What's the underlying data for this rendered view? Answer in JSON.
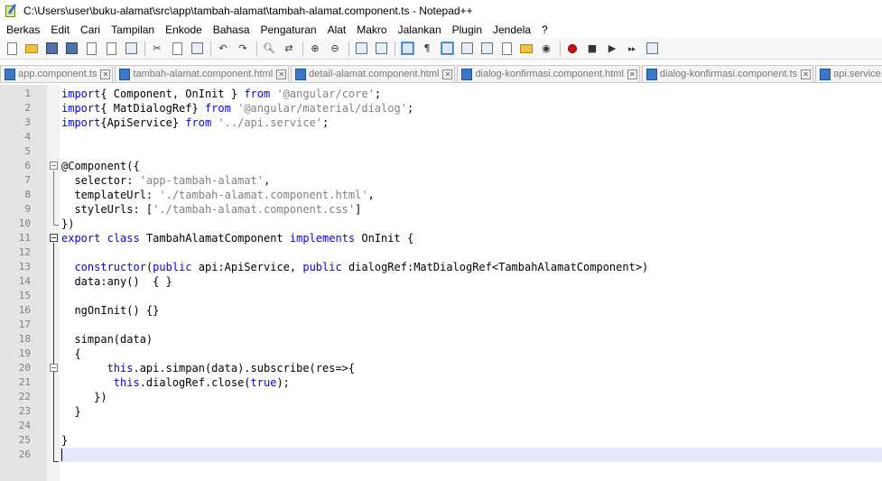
{
  "window": {
    "title": "C:\\Users\\user\\buku-alamat\\src\\app\\tambah-alamat\\tambah-alamat.component.ts - Notepad++"
  },
  "menu": [
    "Berkas",
    "Edit",
    "Cari",
    "Tampilan",
    "Enkode",
    "Bahasa",
    "Pengaturan",
    "Alat",
    "Makro",
    "Jalankan",
    "Plugin",
    "Jendela",
    "?"
  ],
  "toolbar": {
    "icons": [
      "new-file-icon",
      "open-file-icon",
      "save-icon",
      "save-all-icon",
      "close-icon",
      "close-all-icon",
      "print-icon",
      "cut-icon",
      "copy-icon",
      "paste-icon",
      "undo-icon",
      "redo-icon",
      "find-icon",
      "replace-icon",
      "zoom-in-icon",
      "zoom-out-icon",
      "sync-vertical-icon",
      "sync-horizontal-icon",
      "word-wrap-icon",
      "show-all-characters-icon",
      "indent-guide-icon",
      "user-defined-language-icon",
      "document-map-icon",
      "function-list-icon",
      "folder-workspace-icon",
      "monitoring-icon",
      "record-macro-icon",
      "stop-recording-icon",
      "playback-icon",
      "run-macro-multiple-icon",
      "save-macro-icon"
    ]
  },
  "tabs": [
    {
      "label": "app.component.ts",
      "active": false
    },
    {
      "label": "tambah-alamat.component.html",
      "active": false
    },
    {
      "label": "detail-alamat.component.html",
      "active": false
    },
    {
      "label": "dialog-konfirmasi.component.html",
      "active": false
    },
    {
      "label": "dialog-konfirmasi.component.ts",
      "active": false
    },
    {
      "label": "api.service.ts",
      "active": false
    }
  ],
  "editor": {
    "current_line": 26,
    "lines": [
      {
        "n": "1",
        "code": [
          [
            "kw",
            "import"
          ],
          [
            "",
            "{ Component, OnInit } "
          ],
          [
            "kw",
            "from"
          ],
          [
            "",
            " "
          ],
          [
            "str",
            "'@angular/core'"
          ],
          [
            "",
            ";"
          ]
        ]
      },
      {
        "n": "2",
        "code": [
          [
            "kw",
            "import"
          ],
          [
            "",
            "{ MatDialogRef} "
          ],
          [
            "kw",
            "from"
          ],
          [
            "",
            " "
          ],
          [
            "str",
            "'@angular/material/dialog'"
          ],
          [
            "",
            ";"
          ]
        ]
      },
      {
        "n": "3",
        "code": [
          [
            "kw",
            "import"
          ],
          [
            "",
            "{ApiService} "
          ],
          [
            "kw",
            "from"
          ],
          [
            "",
            " "
          ],
          [
            "str",
            "'../api.service'"
          ],
          [
            "",
            ";"
          ]
        ]
      },
      {
        "n": "4",
        "code": []
      },
      {
        "n": "5",
        "code": []
      },
      {
        "n": "6",
        "code": [
          [
            "",
            "@Component({"
          ]
        ]
      },
      {
        "n": "7",
        "code": [
          [
            "",
            "  selector: "
          ],
          [
            "str",
            "'app-tambah-alamat'"
          ],
          [
            "",
            ","
          ]
        ]
      },
      {
        "n": "8",
        "code": [
          [
            "",
            "  templateUrl: "
          ],
          [
            "str",
            "'./tambah-alamat.component.html'"
          ],
          [
            "",
            ","
          ]
        ]
      },
      {
        "n": "9",
        "code": [
          [
            "",
            "  styleUrls: ["
          ],
          [
            "str",
            "'./tambah-alamat.component.css'"
          ],
          [
            "",
            "]"
          ]
        ]
      },
      {
        "n": "10",
        "code": [
          [
            "",
            "})"
          ]
        ]
      },
      {
        "n": "11",
        "code": [
          [
            "kw",
            "export"
          ],
          [
            "",
            " "
          ],
          [
            "kw",
            "class"
          ],
          [
            "",
            " TambahAlamatComponent "
          ],
          [
            "kw",
            "implements"
          ],
          [
            "",
            " OnInit {"
          ]
        ]
      },
      {
        "n": "12",
        "code": []
      },
      {
        "n": "13",
        "code": [
          [
            "",
            "  "
          ],
          [
            "kw",
            "constructor"
          ],
          [
            "",
            "("
          ],
          [
            "kw",
            "public"
          ],
          [
            "",
            " api:ApiService, "
          ],
          [
            "kw",
            "public"
          ],
          [
            "",
            " dialogRef:MatDialogRef<TambahAlamatComponent>)"
          ]
        ]
      },
      {
        "n": "14",
        "code": [
          [
            "",
            "  data:any()  { }"
          ]
        ]
      },
      {
        "n": "15",
        "code": []
      },
      {
        "n": "16",
        "code": [
          [
            "",
            "  ngOnInit() {}"
          ]
        ]
      },
      {
        "n": "17",
        "code": []
      },
      {
        "n": "18",
        "code": [
          [
            "",
            "  simpan(data)"
          ]
        ]
      },
      {
        "n": "19",
        "code": [
          [
            "",
            "  {"
          ]
        ]
      },
      {
        "n": "20",
        "code": [
          [
            "",
            "       "
          ],
          [
            "kw",
            "this"
          ],
          [
            "",
            ".api.simpan(data).subscribe(res=>{"
          ]
        ]
      },
      {
        "n": "21",
        "code": [
          [
            "",
            "        "
          ],
          [
            "kw",
            "this"
          ],
          [
            "",
            ".dialogRef.close("
          ],
          [
            "kw",
            "true"
          ],
          [
            "",
            ");"
          ]
        ]
      },
      {
        "n": "22",
        "code": [
          [
            "",
            "     })"
          ]
        ]
      },
      {
        "n": "23",
        "code": [
          [
            "",
            "  }"
          ]
        ]
      },
      {
        "n": "24",
        "code": []
      },
      {
        "n": "25",
        "code": [
          [
            "",
            "}"
          ]
        ]
      },
      {
        "n": "26",
        "code": []
      }
    ]
  }
}
